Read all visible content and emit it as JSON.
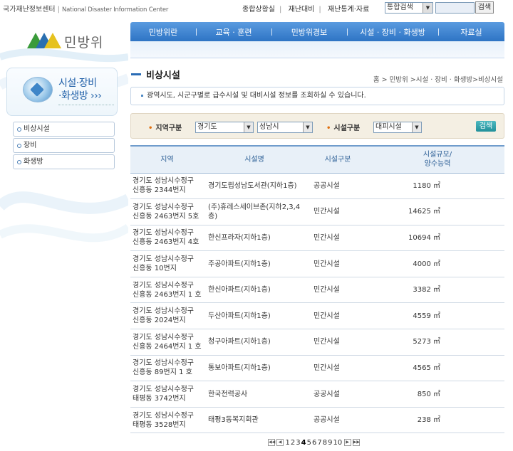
{
  "header": {
    "org_kr": "국가재난정보센터",
    "org_en": "National Disaster Information Center",
    "links": [
      "종합상황실",
      "재난대비",
      "재난통계·자료"
    ],
    "search_scope": "통합검색",
    "search_button": "검색"
  },
  "logo_text": "민방위",
  "nav": [
    "민방위란",
    "교육 · 훈련",
    "민방위경보",
    "시설 · 장비 · 화생방",
    "자료실"
  ],
  "sidebar": {
    "title_line1": "시설·장비",
    "title_line2": "·화생방 ›››",
    "items": [
      "비상시설",
      "장비",
      "화생방"
    ]
  },
  "page_title": "비상시설",
  "breadcrumb": "홈 > 민방위 >시설 · 장비 · 화생방>비상시설",
  "description": "광역시도, 시군구별로 급수시설 및 대비시설 정보를 조회하실 수 있습니다.",
  "search": {
    "region_label": "지역구분",
    "region1": "경기도",
    "region2": "성남시",
    "facility_label": "시설구분",
    "facility": "대피시설",
    "button": "검색"
  },
  "table": {
    "headers": [
      "지역",
      "시설명",
      "시설구분",
      "시설규모/\n양수능력"
    ],
    "rows": [
      [
        "경기도 성남시수정구 신흥동 2344번지",
        "경기도립성남도서관(지하1층)",
        "공공시설",
        "1180 ㎡"
      ],
      [
        "경기도 성남시수정구 신흥동 2463번지 5호",
        "(주)휴레스세이브존(지하2,3,4층)",
        "민간시설",
        "14625 ㎡"
      ],
      [
        "경기도 성남시수정구 신흥동 2463번지 4호",
        "한신프라자(지하1층)",
        "민간시설",
        "10694 ㎡"
      ],
      [
        "경기도 성남시수정구 신흥동 10번지",
        "주공아파트(지하1층)",
        "민간시설",
        "4000 ㎡"
      ],
      [
        "경기도 성남시수정구 신흥동 2463번지 1 호",
        "한신아파트(지하1층)",
        "민간시설",
        "3382 ㎡"
      ],
      [
        "경기도 성남시수정구 신흥동 2024번지",
        "두산아파트(지하1층)",
        "민간시설",
        "4559 ㎡"
      ],
      [
        "경기도 성남시수정구 신흥동 2464번지 1 호",
        "청구아파트(지하1층)",
        "민간시설",
        "5273 ㎡"
      ],
      [
        "경기도 성남시수정구 신흥동 89번지 1 호",
        "통보아파트(지하1층)",
        "민간시설",
        "4565 ㎡"
      ],
      [
        "경기도 성남시수정구 태평동 3742번지",
        "한국전력공사",
        "공공시설",
        "850 ㎡"
      ],
      [
        "경기도 성남시수정구 태평동 3528번지",
        "태평3동복지회관",
        "공공시설",
        "238 ㎡"
      ]
    ]
  },
  "pagination": {
    "pages": [
      "1",
      "2",
      "3",
      "4",
      "5",
      "6",
      "7",
      "8",
      "9",
      "10"
    ],
    "current": "4"
  }
}
